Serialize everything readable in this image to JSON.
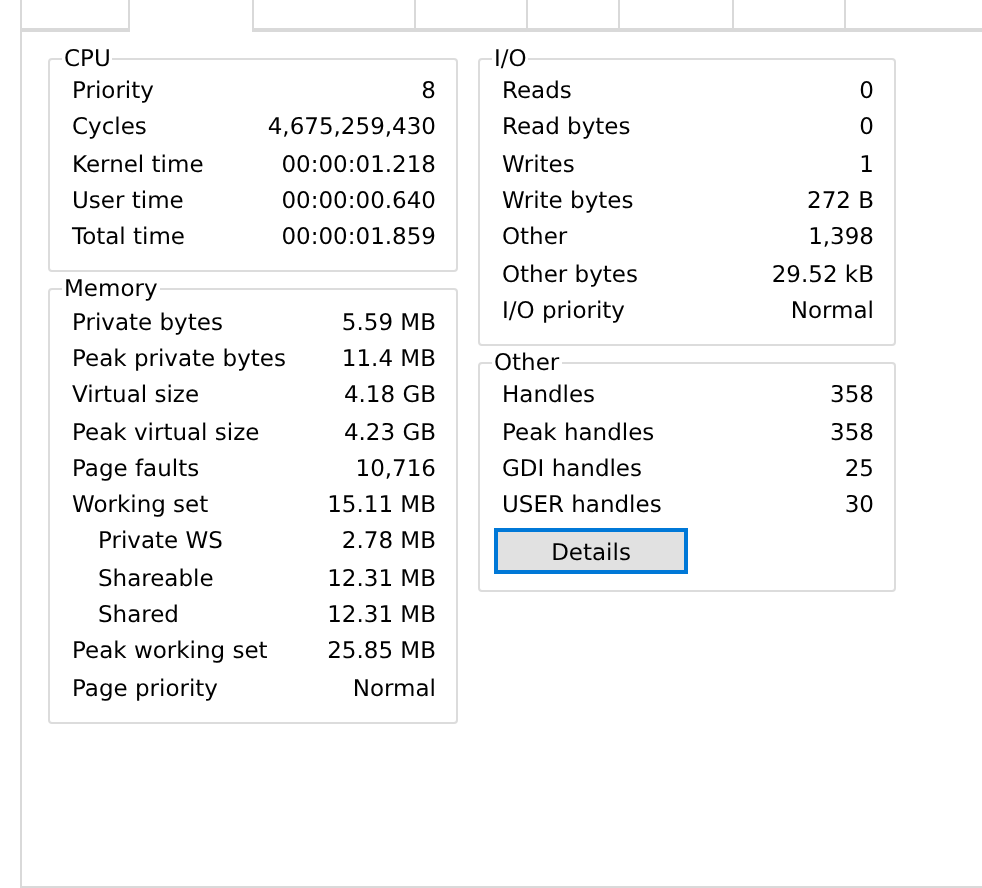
{
  "tabs": [
    {
      "selected": false
    },
    {
      "selected": true
    },
    {
      "selected": false
    },
    {
      "selected": false
    },
    {
      "selected": false
    },
    {
      "selected": false
    },
    {
      "selected": false
    },
    {
      "selected": false
    }
  ],
  "columns": [
    {
      "groups": [
        {
          "title": "CPU",
          "rows": [
            {
              "label": "Priority",
              "value": "8"
            },
            {
              "label": "Cycles",
              "value": "4,675,259,430"
            },
            {
              "label": "Kernel time",
              "value": "00:00:01.218"
            },
            {
              "label": "User time",
              "value": "00:00:00.640"
            },
            {
              "label": "Total time",
              "value": "00:00:01.859"
            }
          ]
        },
        {
          "title": "Memory",
          "rows": [
            {
              "label": "Private bytes",
              "value": "5.59 MB"
            },
            {
              "label": "Peak private bytes",
              "value": "11.4 MB"
            },
            {
              "label": "Virtual size",
              "value": "4.18 GB"
            },
            {
              "label": "Peak virtual size",
              "value": "4.23 GB"
            },
            {
              "label": "Page faults",
              "value": "10,716"
            },
            {
              "label": "Working set",
              "value": "15.11 MB",
              "children": [
                {
                  "label": "Private WS",
                  "value": "2.78 MB"
                },
                {
                  "label": "Shareable",
                  "value": "12.31 MB"
                },
                {
                  "label": "Shared",
                  "value": "12.31 MB"
                }
              ]
            },
            {
              "label": "Peak working set",
              "value": "25.85 MB"
            },
            {
              "label": "Page priority",
              "value": "Normal"
            }
          ]
        }
      ]
    },
    {
      "groups": [
        {
          "title": "I/O",
          "rows": [
            {
              "label": "Reads",
              "value": "0"
            },
            {
              "label": "Read bytes",
              "value": "0"
            },
            {
              "label": "Writes",
              "value": "1"
            },
            {
              "label": "Write bytes",
              "value": "272 B"
            },
            {
              "label": "Other",
              "value": "1,398"
            },
            {
              "label": "Other bytes",
              "value": "29.52 kB"
            },
            {
              "label": "I/O priority",
              "value": "Normal"
            }
          ]
        },
        {
          "title": "Other",
          "rows": [
            {
              "label": "Handles",
              "value": "358"
            },
            {
              "label": "Peak handles",
              "value": "358"
            },
            {
              "label": "GDI handles",
              "value": "25"
            },
            {
              "label": "USER handles",
              "value": "30"
            }
          ],
          "button": "Details"
        }
      ]
    }
  ]
}
